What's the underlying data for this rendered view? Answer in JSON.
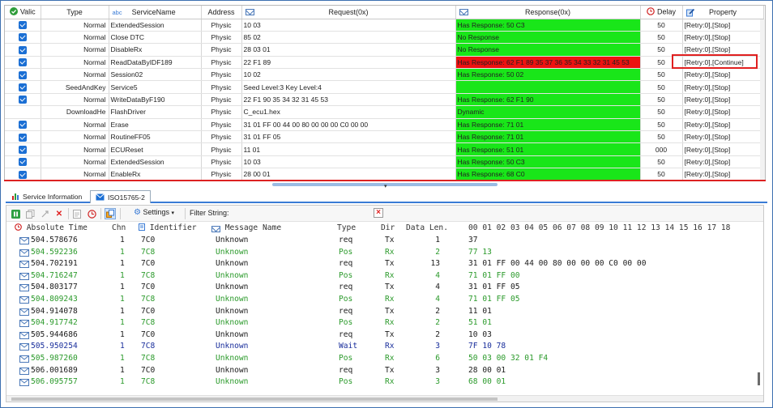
{
  "grid": {
    "columns": {
      "valid": "Valic",
      "type": "Type",
      "abc": "abc",
      "service": "ServiceName",
      "address": "Address",
      "request": "Request(0x)",
      "response": "Response(0x)",
      "delay": "Delay",
      "property": "Property"
    },
    "rows": [
      {
        "checked": true,
        "type": "Normal",
        "service": "ExtendedSession",
        "address": "Physic",
        "request": "10 03",
        "response": "Has Response: 50 C3",
        "resp_status": "green",
        "delay": "50",
        "property": "[Retry:0],[Stop]"
      },
      {
        "checked": true,
        "type": "Normal",
        "service": "Close DTC",
        "address": "Physic",
        "request": "85 02",
        "response": "No Response",
        "resp_status": "green",
        "delay": "50",
        "property": "[Retry:0],[Stop]"
      },
      {
        "checked": true,
        "type": "Normal",
        "service": "DisableRx",
        "address": "Physic",
        "request": "28 03 01",
        "response": "No Response",
        "resp_status": "green",
        "delay": "50",
        "property": "[Retry:0],[Stop]"
      },
      {
        "checked": true,
        "type": "Normal",
        "service": "ReadDataByIDF189",
        "address": "Physic",
        "request": "22 F1 89",
        "response": "Has Response: 62 F1 89 35 37 36 35 34 33 32 31 45 53",
        "resp_status": "red",
        "delay": "50",
        "property": "[Retry:0],[Continue]"
      },
      {
        "checked": true,
        "type": "Normal",
        "service": "Session02",
        "address": "Physic",
        "request": "10 02",
        "response": "Has Response: 50 02",
        "resp_status": "green",
        "delay": "50",
        "property": "[Retry:0],[Stop]"
      },
      {
        "checked": true,
        "type": "SeedAndKey",
        "service": "Service5",
        "address": "Physic",
        "request": "Seed Level:3 Key Level:4",
        "response": "",
        "resp_status": "green",
        "delay": "50",
        "property": "[Retry:0],[Stop]"
      },
      {
        "checked": true,
        "type": "Normal",
        "service": "WriteDataByF190",
        "address": "Physic",
        "request": "22 F1 90 35 34 32 31 45 53",
        "response": "Has Response: 62 F1 90",
        "resp_status": "green",
        "delay": "50",
        "property": "[Retry:0],[Stop]"
      },
      {
        "checked": false,
        "type": "DownloadHe",
        "service": "FlashDriver",
        "address": "Physic",
        "request": "C_ecu1.hex",
        "response": "Dynamic",
        "resp_status": "green",
        "delay": "50",
        "property": "[Retry:0],[Stop]"
      },
      {
        "checked": true,
        "type": "Normal",
        "service": "Erase",
        "address": "Physic",
        "request": "31 01 FF 00 44 00 80 00 00 00 C0 00 00",
        "response": "Has Response: 71 01",
        "resp_status": "green",
        "delay": "50",
        "property": "[Retry:0],[Stop]"
      },
      {
        "checked": true,
        "type": "Normal",
        "service": "RoutineFF05",
        "address": "Physic",
        "request": "31 01 FF 05",
        "response": "Has Response: 71 01",
        "resp_status": "green",
        "delay": "50",
        "property": "[Retry:0],[Stop]"
      },
      {
        "checked": true,
        "type": "Normal",
        "service": "ECUReset",
        "address": "Physic",
        "request": "11 01",
        "response": "Has Response: 51 01",
        "resp_status": "green",
        "delay": "000",
        "property": "[Retry:0],[Stop]"
      },
      {
        "checked": true,
        "type": "Normal",
        "service": "ExtendedSession",
        "address": "Physic",
        "request": "10 03",
        "response": "Has Response: 50 C3",
        "resp_status": "green",
        "delay": "50",
        "property": "[Retry:0],[Stop]"
      },
      {
        "checked": true,
        "type": "Normal",
        "service": "EnableRx",
        "address": "Physic",
        "request": "28 00 01",
        "response": "Has Response: 68 C0",
        "resp_status": "green",
        "delay": "50",
        "property": "[Retry:0],[Stop]"
      }
    ]
  },
  "tabs": [
    {
      "label": "Service Information"
    },
    {
      "label": "ISO15765-2"
    }
  ],
  "toolbar": {
    "settings_label": "Settings",
    "filter_label": "Filter String:",
    "filter_value": ""
  },
  "trace": {
    "headers": {
      "time": "Absolute Time",
      "chn": "Chn",
      "id": "Identifier",
      "msg": "Message Name",
      "type": "Type",
      "dir": "Dir",
      "len": "Data Len.",
      "bytes": "00 01 02 03 04 05 06 07 08 09 10 11 12 13 14 15 16 17 18"
    },
    "rows": [
      {
        "style": "dark",
        "time": "504.578676",
        "chn": "1",
        "id": "7C0",
        "msg": "Unknown",
        "type": "req",
        "dir": "Tx",
        "len": "1",
        "data": "37"
      },
      {
        "style": "green",
        "time": "504.592236",
        "chn": "1",
        "id": "7C8",
        "msg": "Unknown",
        "type": "Pos",
        "dir": "Rx",
        "len": "2",
        "data": "77 13"
      },
      {
        "style": "dark",
        "time": "504.702191",
        "chn": "1",
        "id": "7C0",
        "msg": "Unknown",
        "type": "req",
        "dir": "Tx",
        "len": "13",
        "data": "31 01 FF 00 44 00 80 00 00 00 C0 00 00"
      },
      {
        "style": "green",
        "time": "504.716247",
        "chn": "1",
        "id": "7C8",
        "msg": "Unknown",
        "type": "Pos",
        "dir": "Rx",
        "len": "4",
        "data": "71 01 FF 00"
      },
      {
        "style": "dark",
        "time": "504.803177",
        "chn": "1",
        "id": "7C0",
        "msg": "Unknown",
        "type": "req",
        "dir": "Tx",
        "len": "4",
        "data": "31 01 FF 05"
      },
      {
        "style": "green",
        "time": "504.809243",
        "chn": "1",
        "id": "7C8",
        "msg": "Unknown",
        "type": "Pos",
        "dir": "Rx",
        "len": "4",
        "data": "71 01 FF 05"
      },
      {
        "style": "dark",
        "time": "504.914078",
        "chn": "1",
        "id": "7C0",
        "msg": "Unknown",
        "type": "req",
        "dir": "Tx",
        "len": "2",
        "data": "11 01"
      },
      {
        "style": "green",
        "time": "504.917742",
        "chn": "1",
        "id": "7C8",
        "msg": "Unknown",
        "type": "Pos",
        "dir": "Rx",
        "len": "2",
        "data": "51 01"
      },
      {
        "style": "dark",
        "time": "505.944686",
        "chn": "1",
        "id": "7C0",
        "msg": "Unknown",
        "type": "req",
        "dir": "Tx",
        "len": "2",
        "data": "10 03"
      },
      {
        "style": "wait",
        "time": "505.950254",
        "chn": "1",
        "id": "7C8",
        "msg": "Unknown",
        "type": "Wait",
        "dir": "Rx",
        "len": "3",
        "data": "7F 10 78"
      },
      {
        "style": "green",
        "time": "505.987260",
        "chn": "1",
        "id": "7C8",
        "msg": "Unknown",
        "type": "Pos",
        "dir": "Rx",
        "len": "6",
        "data": "50 03 00 32 01 F4"
      },
      {
        "style": "dark",
        "time": "506.001689",
        "chn": "1",
        "id": "7C0",
        "msg": "Unknown",
        "type": "req",
        "dir": "Tx",
        "len": "3",
        "data": "28 00 01"
      },
      {
        "style": "green",
        "time": "506.095757",
        "chn": "1",
        "id": "7C8",
        "msg": "Unknown",
        "type": "Pos",
        "dir": "Rx",
        "len": "3",
        "data": "68 00 01"
      }
    ]
  },
  "colors": {
    "green": "#19e619",
    "red": "#ee1111",
    "accent": "#3a7bd5"
  }
}
